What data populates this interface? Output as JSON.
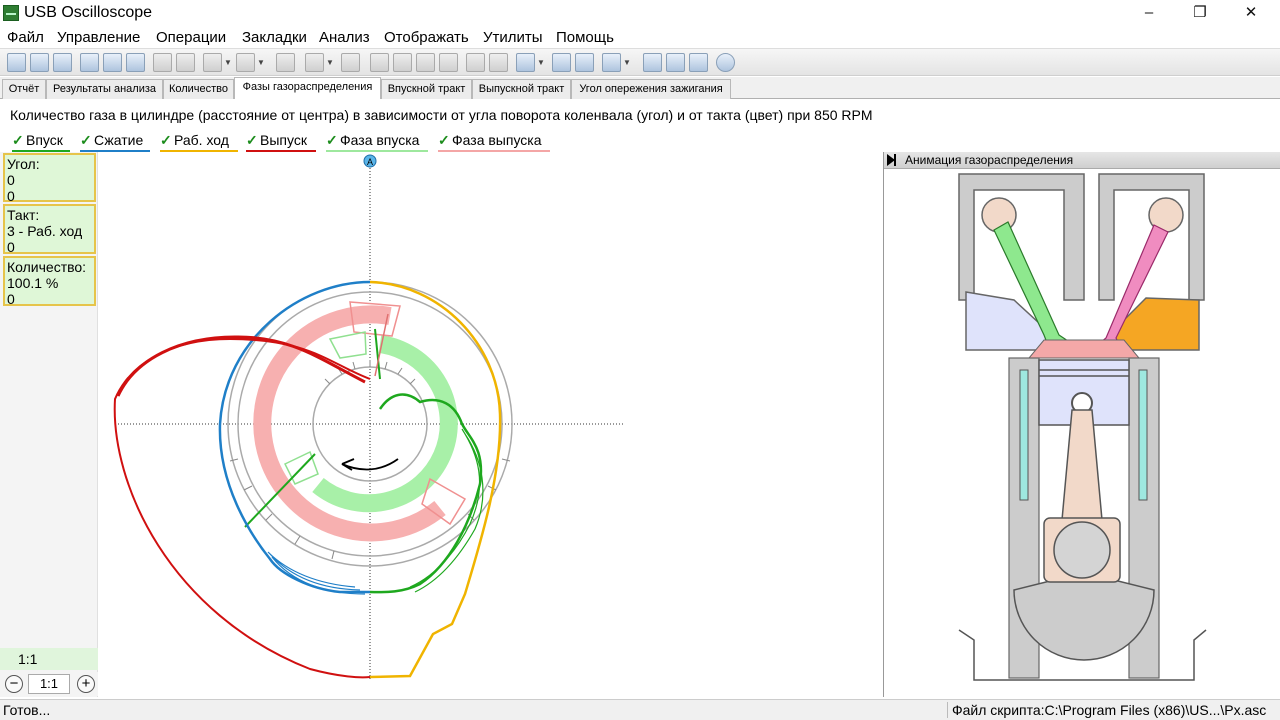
{
  "window": {
    "title": "USB Oscilloscope",
    "controls": {
      "minimize": "–",
      "maximize": "❐",
      "close": "✕"
    }
  },
  "menu": [
    "Файл",
    "Управление",
    "Операции",
    "Закладки",
    "Анализ",
    "Отображать",
    "Утилиты",
    "Помощь"
  ],
  "tabs": {
    "items": [
      "Отчёт",
      "Результаты анализа",
      "Количество",
      "Фазы газораспределения",
      "Впускной тракт",
      "Выпускной тракт",
      "Угол опережения зажигания"
    ],
    "active": "Фазы газораспределения"
  },
  "chart": {
    "title": "Количество газа в цилиндре (расстояние от центра) в зависимости от угла поворота коленвала (угол) и от такта (цвет) при 850 RPM",
    "marker_label": "A"
  },
  "legend": [
    {
      "label": "Впуск",
      "color": "#1ea81e"
    },
    {
      "label": "Сжатие",
      "color": "#1f7fc8"
    },
    {
      "label": "Раб. ход",
      "color": "#f0b400"
    },
    {
      "label": "Выпуск",
      "color": "#d01010"
    },
    {
      "label": "Фаза впуска",
      "color": "#9ee89e"
    },
    {
      "label": "Фаза выпуска",
      "color": "#f4a6a6"
    }
  ],
  "info": {
    "angle": {
      "label": "Угол:",
      "line1": "0",
      "line2": "0"
    },
    "stroke": {
      "label": "Такт:",
      "line1": "3 - Раб. ход",
      "line2": "0"
    },
    "quantity": {
      "label": "Количество:",
      "line1": "100.1 %",
      "line2": "0"
    }
  },
  "zoom": {
    "ratio_label": "1:1",
    "ratio_value": "1:1",
    "minus": "−",
    "plus": "+"
  },
  "animation_panel": {
    "title": "Анимация газораспределения"
  },
  "status": {
    "left": "Готов...",
    "right": "Файл скрипта:C:\\Program Files (x86)\\US...\\Px.asc"
  },
  "colors": {
    "accent_box_bg": "#dff7d7",
    "accent_box_border": "#e6c44a",
    "intake": "#1ea81e",
    "compression": "#1f7fc8",
    "power": "#f0b400",
    "exhaust": "#d01010"
  }
}
